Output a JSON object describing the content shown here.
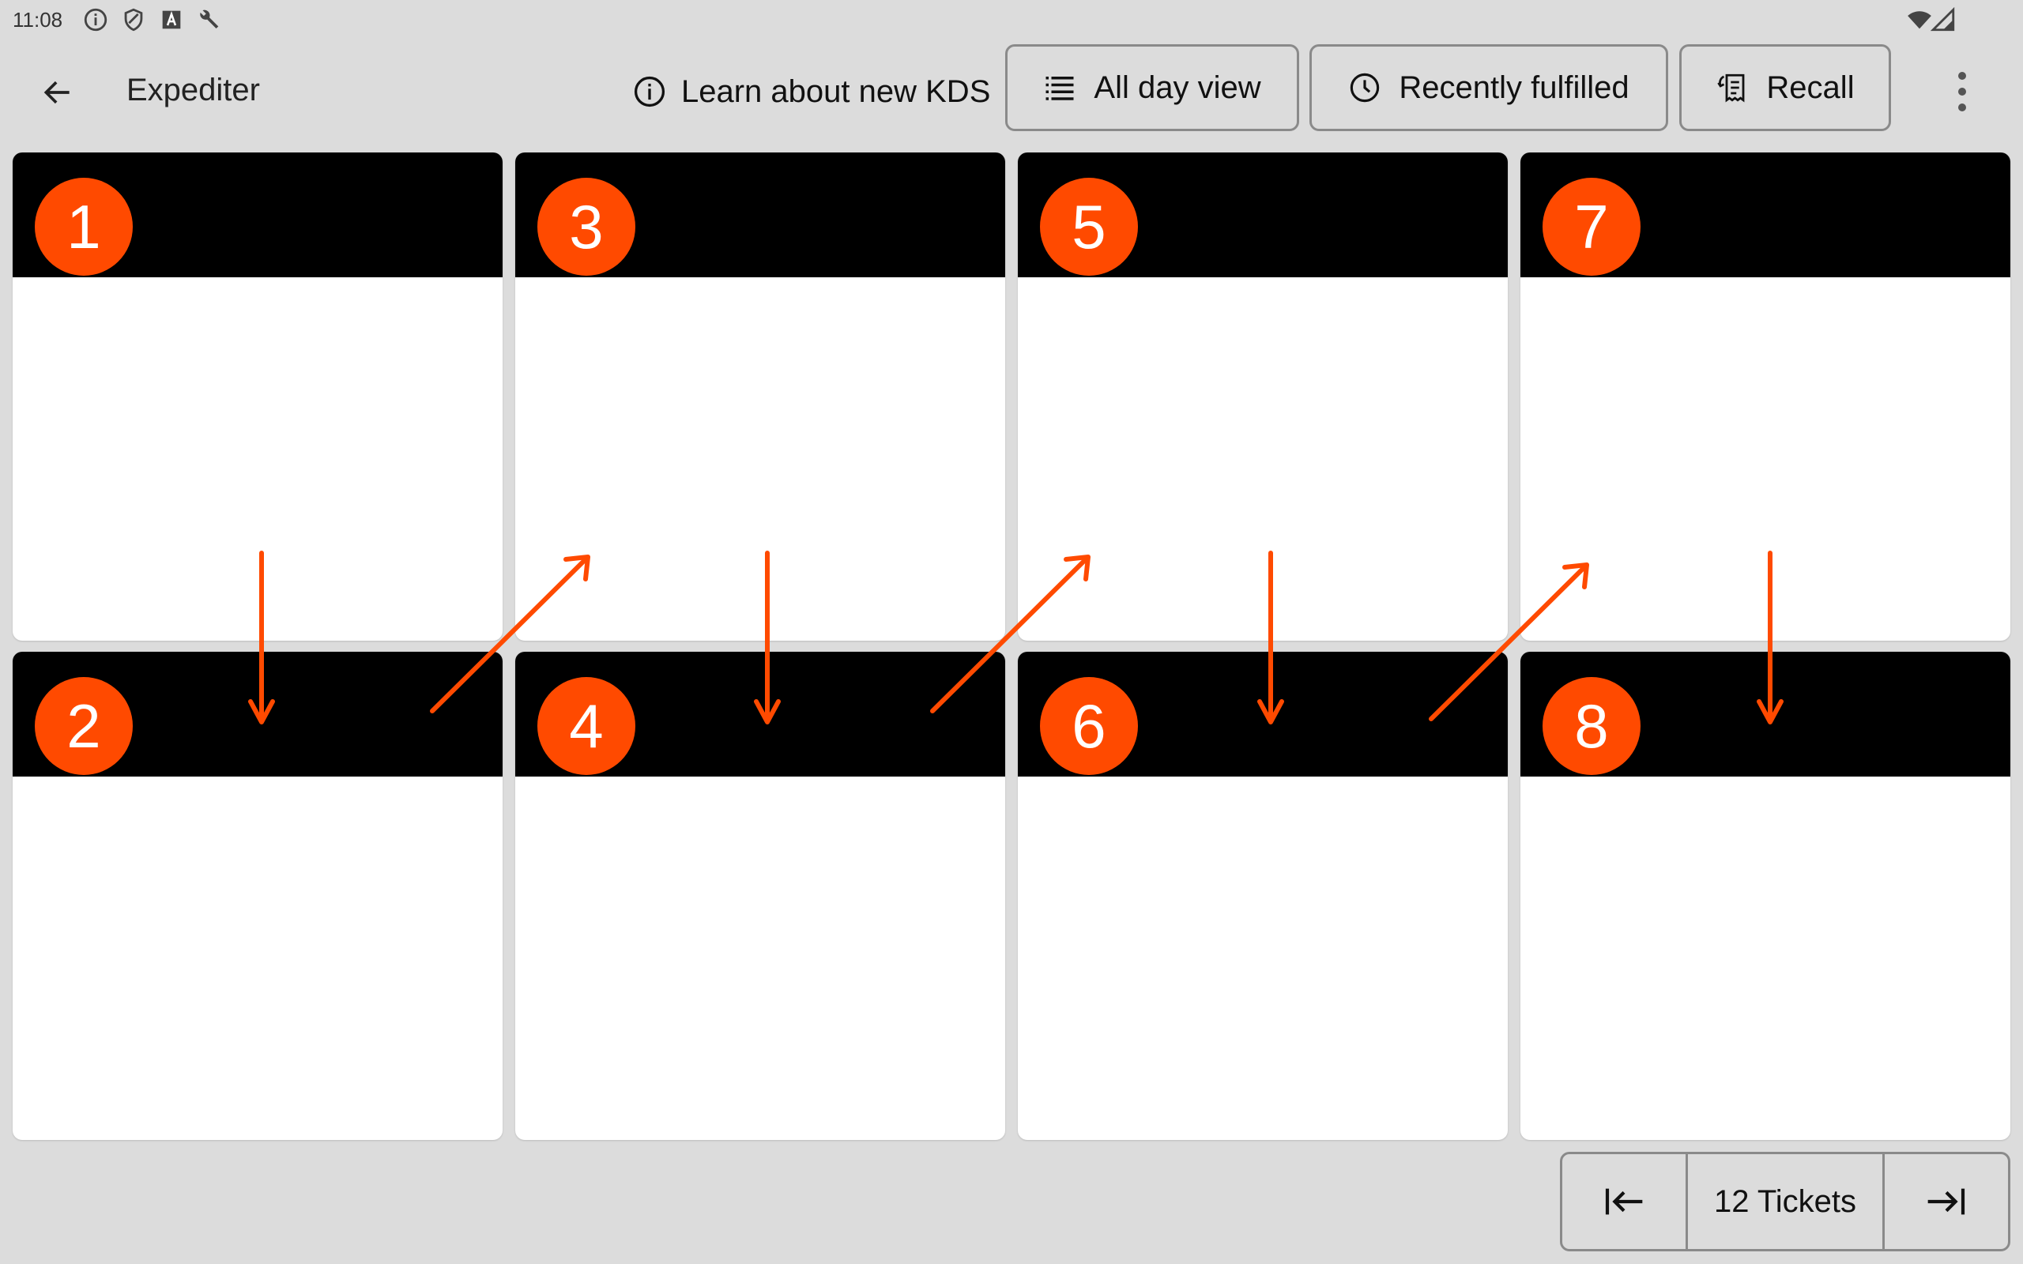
{
  "status_bar": {
    "time": "11:08",
    "left_icons": [
      "info-icon",
      "shield-icon",
      "a-box-icon",
      "wrench-icon"
    ],
    "right_icons": [
      "wifi-icon",
      "cellular-icon"
    ]
  },
  "app_bar": {
    "back_icon": "back-arrow-icon",
    "title": "Expediter",
    "learn_label": "Learn about new KDS",
    "all_day_label": "All day view",
    "recently_fulfilled_label": "Recently fulfilled",
    "recall_label": "Recall",
    "more_icon": "more-vertical-icon"
  },
  "tickets": [
    {
      "number": "1"
    },
    {
      "number": "2"
    },
    {
      "number": "3"
    },
    {
      "number": "4"
    },
    {
      "number": "5"
    },
    {
      "number": "6"
    },
    {
      "number": "7"
    },
    {
      "number": "8"
    }
  ],
  "pagination": {
    "label": "12 Tickets",
    "first_icon": "first-page-icon",
    "last_icon": "last-page-icon"
  },
  "colors": {
    "badge": "#ff4a00",
    "arrow": "#ff4a00",
    "ticket_header": "#000000",
    "background": "#dcdcdc"
  }
}
